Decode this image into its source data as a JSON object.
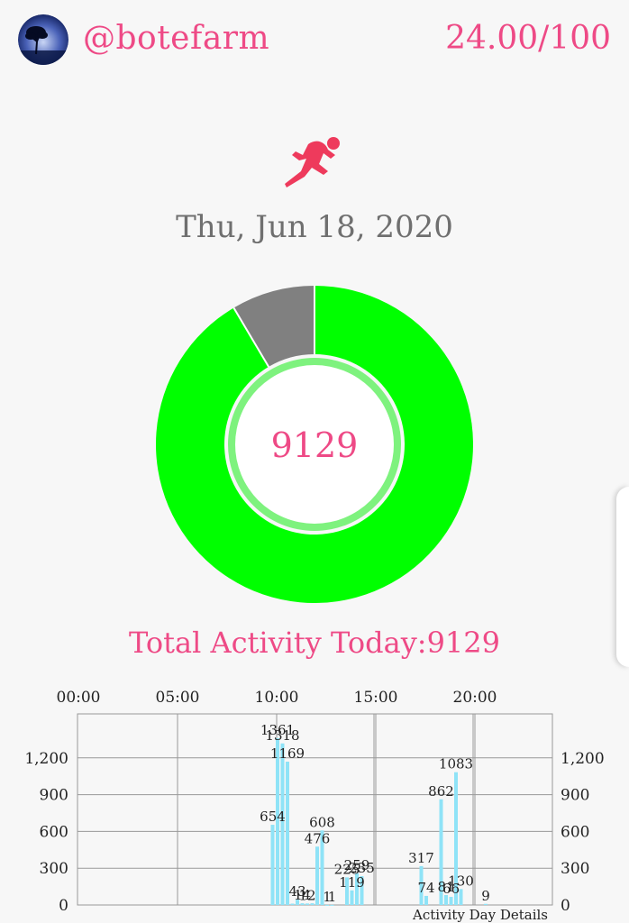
{
  "header": {
    "handle": "@botefarm",
    "score": "24.00/100"
  },
  "date": "Thu, Jun 18, 2020",
  "donut": {
    "center_value": "9129",
    "activity": 9129,
    "remaining_fraction": 0.085,
    "colors": {
      "activity": "#00ff00",
      "remaining": "#808080",
      "inner_ring": "#7ef27e"
    }
  },
  "total_label": "Total Activity Today:9129",
  "chart_data": {
    "type": "bar",
    "xlabel": "Activity Day Details",
    "top_ticks": [
      "00:00",
      "05:00",
      "10:00",
      "15:00",
      "20:00"
    ],
    "y_ticks": [
      "0",
      "300",
      "600",
      "900",
      "1,200"
    ],
    "ylim": [
      0,
      1500
    ],
    "xlim_hours": [
      0,
      24
    ],
    "bar_color": "#8fe3f7",
    "bars": [
      {
        "hour": 9.75,
        "value": 654,
        "label": "654"
      },
      {
        "hour": 10.0,
        "value": 1361,
        "label": "1361"
      },
      {
        "hour": 10.25,
        "value": 1318,
        "label": "1318"
      },
      {
        "hour": 10.5,
        "value": 1169,
        "label": "1169"
      },
      {
        "hour": 10.75,
        "value": 11,
        "label": ""
      },
      {
        "hour": 11.0,
        "value": 43,
        "label": "43"
      },
      {
        "hour": 11.25,
        "value": 14,
        "label": "14"
      },
      {
        "hour": 11.5,
        "value": 12,
        "label": "12"
      },
      {
        "hour": 11.75,
        "value": 14,
        "label": ""
      },
      {
        "hour": 12.0,
        "value": 476,
        "label": "476"
      },
      {
        "hour": 12.25,
        "value": 608,
        "label": "608"
      },
      {
        "hour": 12.5,
        "value": 1,
        "label": "1"
      },
      {
        "hour": 12.75,
        "value": 1,
        "label": "1"
      },
      {
        "hour": 13.5,
        "value": 225,
        "label": "225"
      },
      {
        "hour": 13.75,
        "value": 119,
        "label": "119"
      },
      {
        "hour": 14.0,
        "value": 259,
        "label": "259"
      },
      {
        "hour": 14.25,
        "value": 235,
        "label": "235"
      },
      {
        "hour": 17.25,
        "value": 317,
        "label": "317"
      },
      {
        "hour": 17.5,
        "value": 74,
        "label": "74"
      },
      {
        "hour": 18.25,
        "value": 862,
        "label": "862"
      },
      {
        "hour": 18.5,
        "value": 81,
        "label": "81"
      },
      {
        "hour": 18.75,
        "value": 66,
        "label": "66"
      },
      {
        "hour": 19.0,
        "value": 1083,
        "label": "1083"
      },
      {
        "hour": 19.25,
        "value": 130,
        "label": "130"
      },
      {
        "hour": 20.5,
        "value": 9,
        "label": "9"
      }
    ]
  }
}
